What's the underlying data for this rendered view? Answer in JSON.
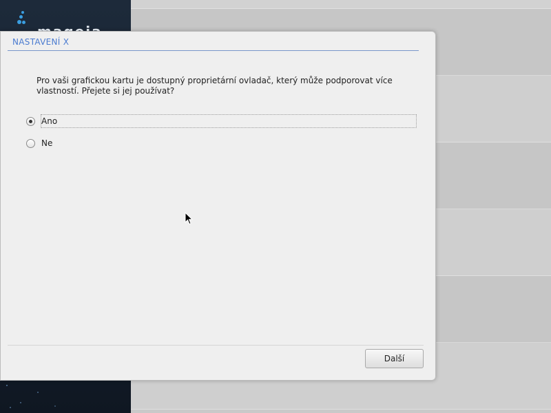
{
  "sidebar": {
    "logo_text": "mageia",
    "logo_icon": "mageia-drops-icon"
  },
  "dialog": {
    "title": "NASTAVENÍ X",
    "question": "Pro vaši grafickou kartu je dostupný proprietární ovladač, který může podporovat více vlastností. Přejete si jej používat?",
    "options": [
      {
        "label": "Ano",
        "selected": true
      },
      {
        "label": "Ne",
        "selected": false
      }
    ],
    "next_button": "Další"
  },
  "colors": {
    "title_accent": "#4a7bd0",
    "sidebar_bg": "#1d2a3a",
    "dialog_bg": "#efefef"
  }
}
